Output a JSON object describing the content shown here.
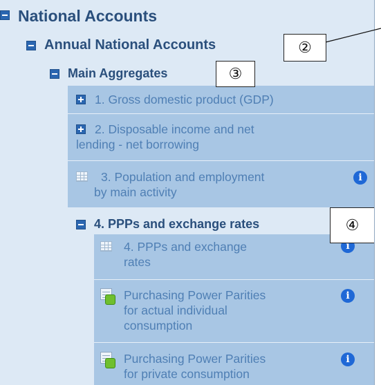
{
  "tree": {
    "national_accounts": "National Accounts",
    "annual_national_accounts": "Annual National Accounts",
    "main_aggregates": "Main Aggregates",
    "items": [
      {
        "label_line1": "1. Gross domestic product (GDP)",
        "label_line2": "",
        "label_line3": "",
        "icon": "plus-icon"
      },
      {
        "label_line1": "2. Disposable income and net",
        "label_line2": "lending - net borrowing",
        "label_line3": "",
        "icon": "plus-icon"
      },
      {
        "label_line1": "3. Population and employment",
        "label_line2": "by main activity",
        "label_line3": "",
        "icon": "table-icon",
        "info": "i"
      }
    ],
    "ppps_folder": "4. PPPs and exchange rates",
    "ppps_items": [
      {
        "label_line1": "4. PPPs and exchange",
        "label_line2": "rates",
        "label_line3": "",
        "icon": "table-icon",
        "info": "i"
      },
      {
        "label_line1": "Purchasing Power Parities",
        "label_line2": "for actual individual",
        "label_line3": "consumption",
        "icon": "extension-icon",
        "info": "i"
      },
      {
        "label_line1": "Purchasing Power Parities",
        "label_line2": "for private consumption",
        "label_line3": "",
        "icon": "extension-icon",
        "info": "i"
      }
    ]
  },
  "callouts": {
    "c2": "②",
    "c3": "③",
    "c4": "④"
  },
  "colors": {
    "tree_bg": "#dde9f5",
    "block_bg": "#a8c6e4",
    "folder_text": "#2a4f7c",
    "leaf_text": "#4f7fb4",
    "expander": "#2a66b1",
    "info": "#1f68d6"
  }
}
